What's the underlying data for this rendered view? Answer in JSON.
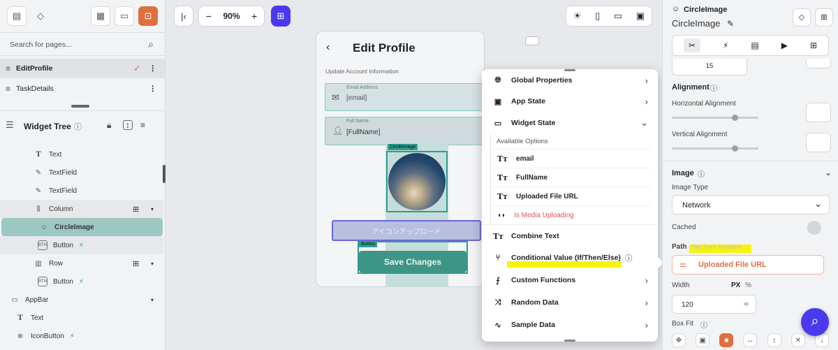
{
  "left_panel": {
    "search_placeholder": "Search for pages...",
    "pages": [
      {
        "name": "EditProfile",
        "active": true
      },
      {
        "name": "TaskDetails",
        "active": false
      }
    ],
    "widget_tree_title": "Widget Tree",
    "tree": [
      {
        "label": "Text",
        "icon": "text-type-icon"
      },
      {
        "label": "TextField",
        "icon": "textfield-icon"
      },
      {
        "label": "TextField",
        "icon": "textfield-icon"
      },
      {
        "label": "Column",
        "icon": "column-icon"
      },
      {
        "label": "CircleImage",
        "icon": "circle-image-icon"
      },
      {
        "label": "Button",
        "icon": "button-icon"
      },
      {
        "label": "Row",
        "icon": "row-icon"
      },
      {
        "label": "Button",
        "icon": "button-icon"
      },
      {
        "label": "AppBar",
        "icon": "appbar-icon"
      },
      {
        "label": "Text",
        "icon": "text-type-icon"
      },
      {
        "label": "IconButton",
        "icon": "iconbutton-icon"
      }
    ]
  },
  "toolbar": {
    "zoom": "90%",
    "minus": "−",
    "plus": "+"
  },
  "phone": {
    "title": "Edit Profile",
    "section": "Update Account Information",
    "email_label": "Email Address",
    "email_value": "[email]",
    "name_label": "Full Name",
    "name_value": "[FullName]",
    "image_tag": "CircleImage",
    "upload_button": "アイコンアップロード",
    "button_tag": "Button",
    "save_button": "Save Changes"
  },
  "popup": {
    "global_properties": "Global Properties",
    "app_state": "App State",
    "widget_state": "Widget State",
    "available_options": "Available Options",
    "options": [
      {
        "label": "email",
        "red": false
      },
      {
        "label": "FullName",
        "red": false
      },
      {
        "label": "Uploaded File URL",
        "red": false
      },
      {
        "label": "Is Media Uploading",
        "red": true
      }
    ],
    "combine_text": "Combine Text",
    "conditional_value": "Conditional Value (If/Then/Else)",
    "custom_functions": "Custom Functions",
    "random_data": "Random Data",
    "sample_data": "Sample Data"
  },
  "right_panel": {
    "widget_type": "CircleImage",
    "widget_name": "CircleImage",
    "value_15": "15",
    "alignment": "Alignment",
    "horizontal_alignment": "Horizontal Alignment",
    "vertical_alignment": "Vertical Alignment",
    "image_section": "Image",
    "image_type_label": "Image Type",
    "image_type_value": "Network",
    "cached_label": "Cached",
    "path_label": "Path",
    "path_hint": "Set from Variable",
    "path_value": "Uploaded File URL",
    "width_label": "Width",
    "px": "PX",
    "pct": "%",
    "width_value": "120",
    "infinity": "∞",
    "box_fit": "Box Fit"
  },
  "colors": {
    "accent": "#4b39ef",
    "orange": "#e0703f",
    "teal": "#5fb3a8",
    "highlight": "#f7f200",
    "red": "#e0544a"
  }
}
